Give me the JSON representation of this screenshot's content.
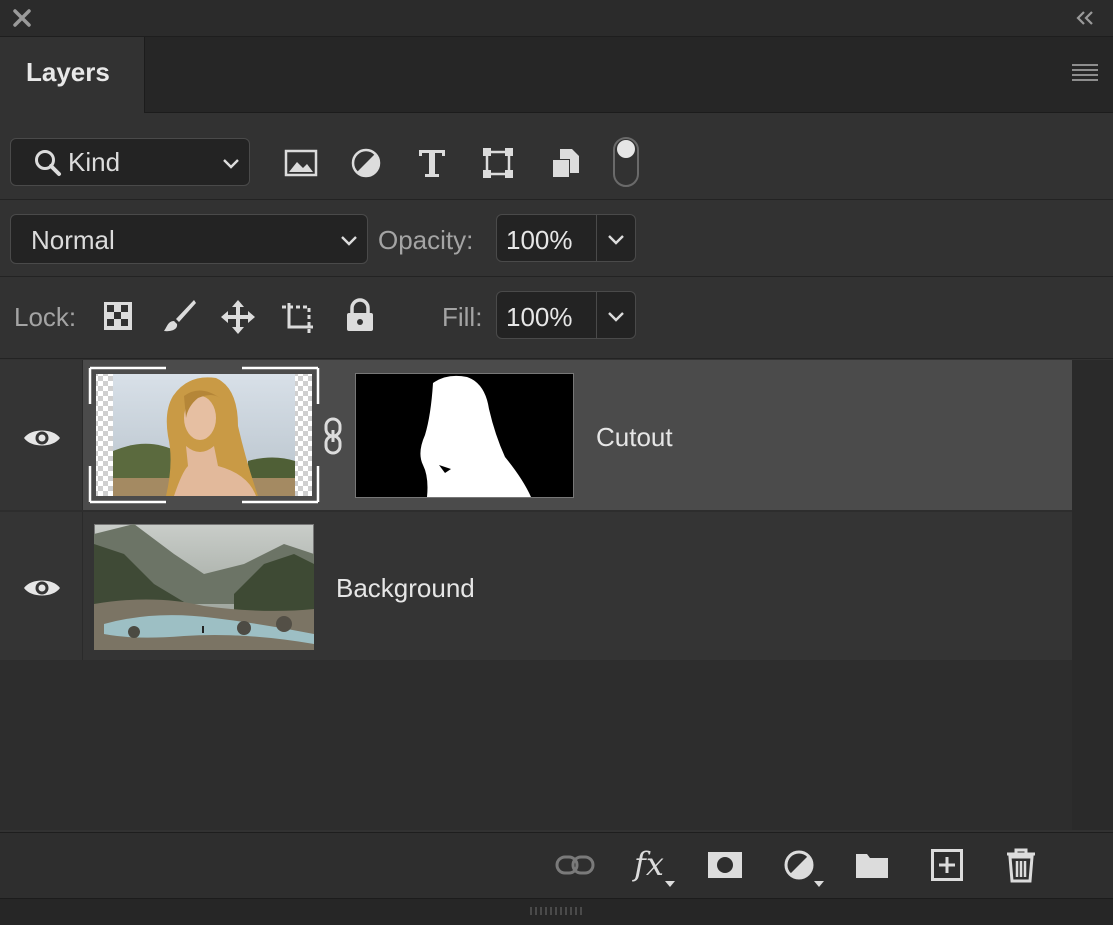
{
  "panel": {
    "tab_label": "Layers"
  },
  "filter": {
    "kind_label": "Kind",
    "icons": [
      "image-filter-icon",
      "adjustment-filter-icon",
      "type-filter-icon",
      "shape-filter-icon",
      "smart-object-filter-icon",
      "filter-toggle-icon"
    ]
  },
  "blend": {
    "mode": "Normal",
    "opacity_label": "Opacity:",
    "opacity_value": "100%"
  },
  "lock": {
    "label": "Lock:",
    "icons": [
      "lock-transparent-pixels-icon",
      "lock-image-pixels-icon",
      "lock-position-icon",
      "lock-artboard-icon",
      "lock-all-icon"
    ],
    "fill_label": "Fill:",
    "fill_value": "100%"
  },
  "layers": [
    {
      "name": "Cutout",
      "visible": true,
      "selected": true,
      "has_mask": true
    },
    {
      "name": "Background",
      "visible": true,
      "selected": false,
      "has_mask": false
    }
  ],
  "footer": {
    "icons": [
      "link-layers-icon",
      "layer-style-fx-icon",
      "add-mask-icon",
      "new-adjustment-layer-icon",
      "new-group-icon",
      "new-layer-icon",
      "delete-layer-icon"
    ],
    "fx_label": "fx"
  },
  "colors": {
    "panel_bg": "#323232",
    "selected_layer_bg": "#4b4b4b",
    "text": "#e6e6e6"
  }
}
